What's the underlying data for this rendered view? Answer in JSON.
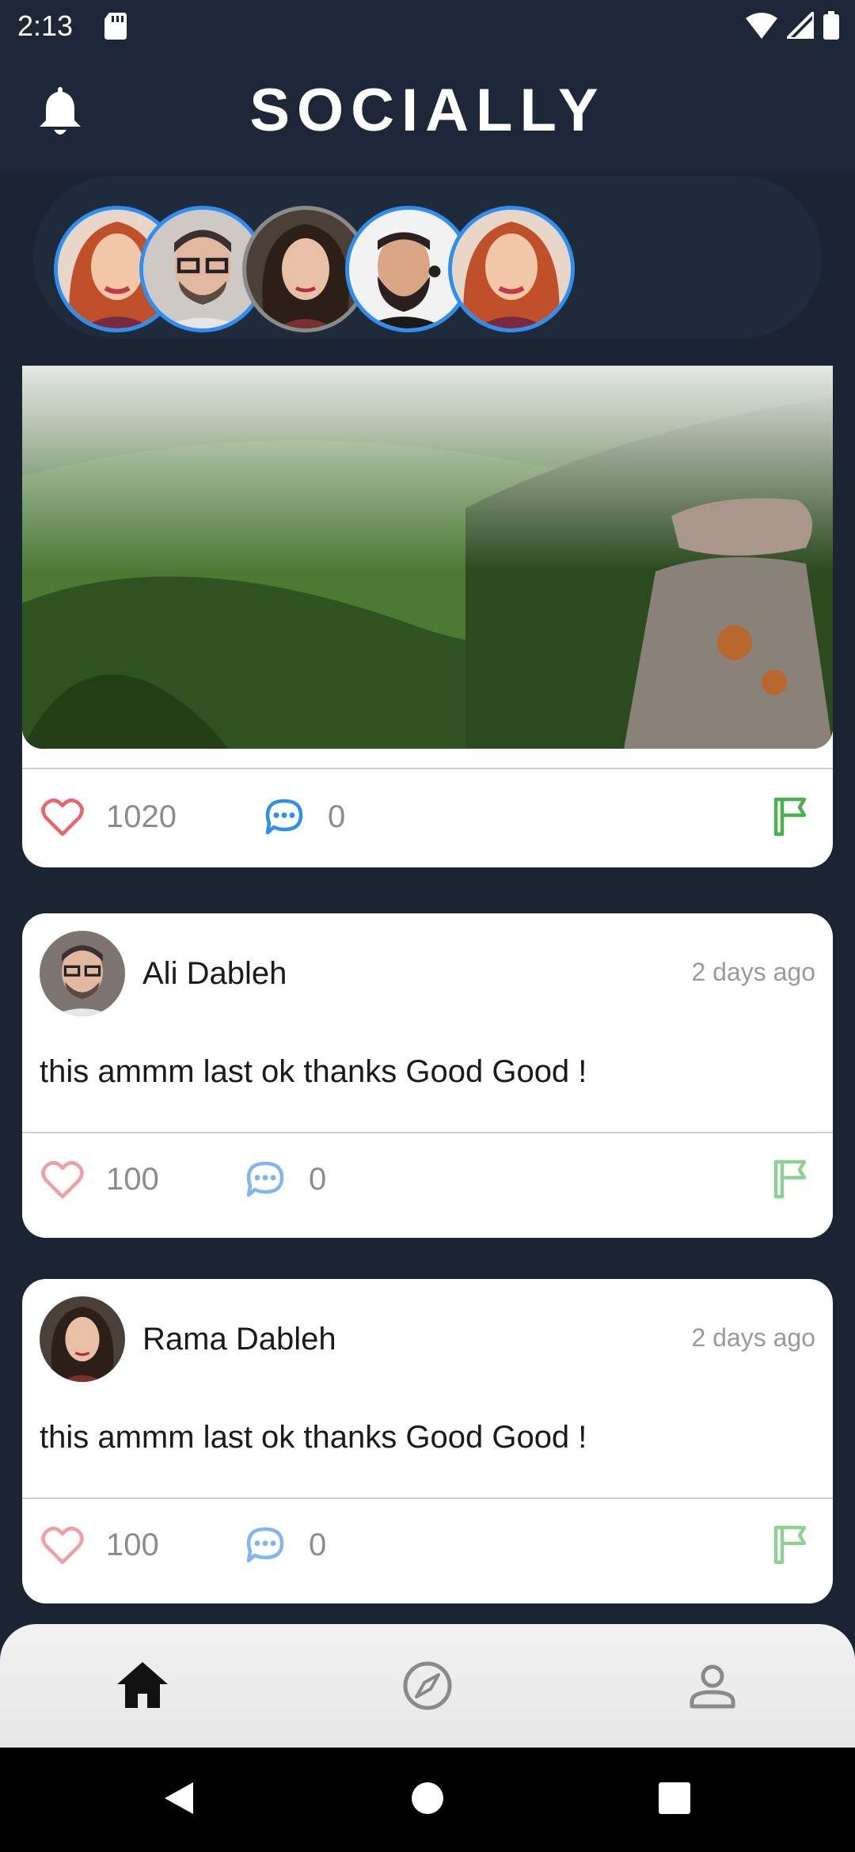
{
  "status_bar": {
    "time": "2:13"
  },
  "header": {
    "title": "SOCIALLY"
  },
  "stories": [
    {
      "name": "story-1"
    },
    {
      "name": "story-2"
    },
    {
      "name": "story-3"
    },
    {
      "name": "story-4"
    },
    {
      "name": "story-5"
    }
  ],
  "posts": [
    {
      "likes": "1020",
      "comments": "0"
    },
    {
      "author": "Ali Dableh",
      "time": "2 days ago",
      "text": "this ammm last ok thanks Good Good !",
      "likes": "100",
      "comments": "0"
    },
    {
      "author": "Rama Dableh",
      "time": "2 days ago",
      "text": "this ammm last ok thanks Good Good !",
      "likes": "100",
      "comments": "0"
    }
  ],
  "colors": {
    "background": "#1a2433",
    "header": "#1e2738",
    "like": "#e9656b",
    "comment": "#2f8ff0",
    "bookmark": "#4caf50",
    "story_ring": "#2f8ff0"
  },
  "icons": {
    "bell": "bell-icon",
    "like": "heart-outline-icon",
    "comment": "chat-bubble-icon",
    "bookmark": "bookmark-icon",
    "nav_home": "home-icon",
    "nav_explore": "compass-icon",
    "nav_profile": "person-icon"
  }
}
